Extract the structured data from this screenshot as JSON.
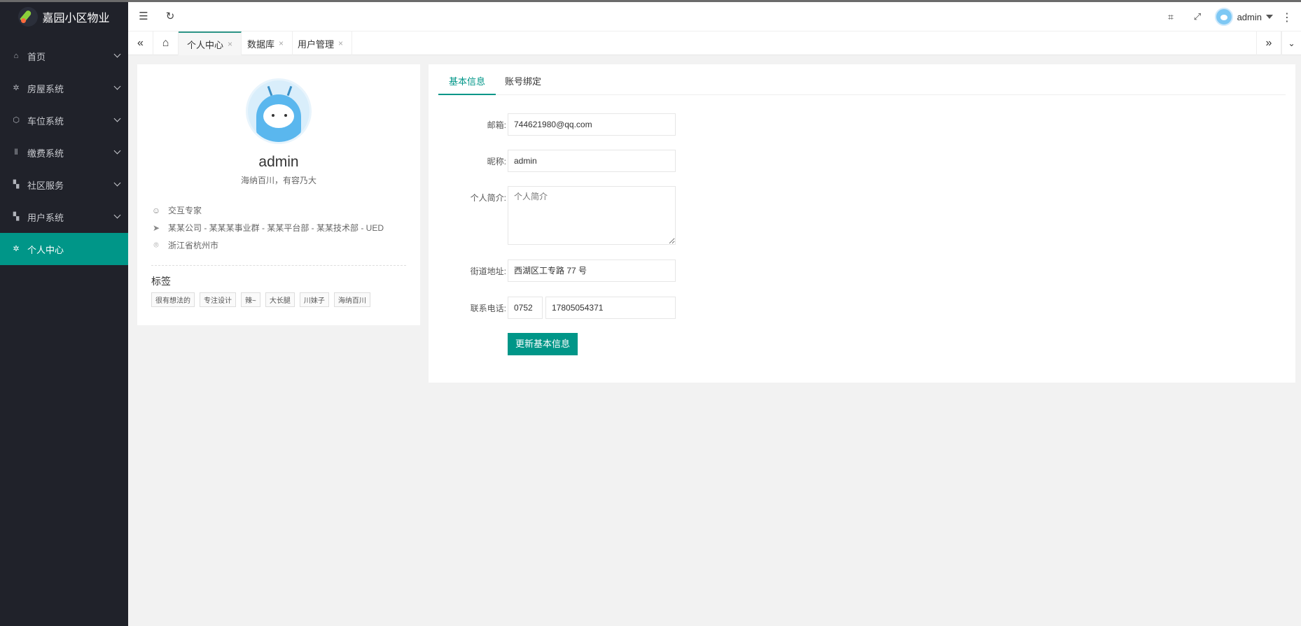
{
  "app": {
    "title": "嘉园小区物业"
  },
  "sidebar": {
    "items": [
      {
        "label": "首页",
        "icon": "home-icon"
      },
      {
        "label": "房屋系统",
        "icon": "gear-icon"
      },
      {
        "label": "车位系统",
        "icon": "cube-icon"
      },
      {
        "label": "缴费系统",
        "icon": "bars-icon"
      },
      {
        "label": "社区服务",
        "icon": "grid-icon"
      },
      {
        "label": "用户系统",
        "icon": "grid-icon"
      },
      {
        "label": "个人中心",
        "icon": "gear-icon",
        "active": true
      }
    ]
  },
  "header": {
    "username": "admin"
  },
  "tabs": [
    {
      "label": "个人中心",
      "active": true
    },
    {
      "label": "数据库"
    },
    {
      "label": "用户管理"
    }
  ],
  "profile": {
    "name": "admin",
    "motto": "海纳百川，有容乃大",
    "title": "交互专家",
    "org": "某某公司 - 某某某事业群 - 某某平台部 - 某某技术部 - UED",
    "location": "浙江省杭州市",
    "tags_title": "标签",
    "tags": [
      "很有想法的",
      "专注设计",
      "辣~",
      "大长腿",
      "川妹子",
      "海纳百川"
    ]
  },
  "form": {
    "tabs": [
      "基本信息",
      "账号绑定"
    ],
    "email_label": "邮箱:",
    "email_value": "744621980@qq.com",
    "nickname_label": "昵称:",
    "nickname_value": "admin",
    "bio_label": "个人简介:",
    "bio_placeholder": "个人简介",
    "address_label": "街道地址:",
    "address_value": "西湖区工专路 77 号",
    "phone_label": "联系电话:",
    "phone_area": "0752",
    "phone_number": "17805054371",
    "submit_label": "更新基本信息"
  },
  "colors": {
    "accent": "#009688",
    "sidebar_bg": "#20222a"
  }
}
